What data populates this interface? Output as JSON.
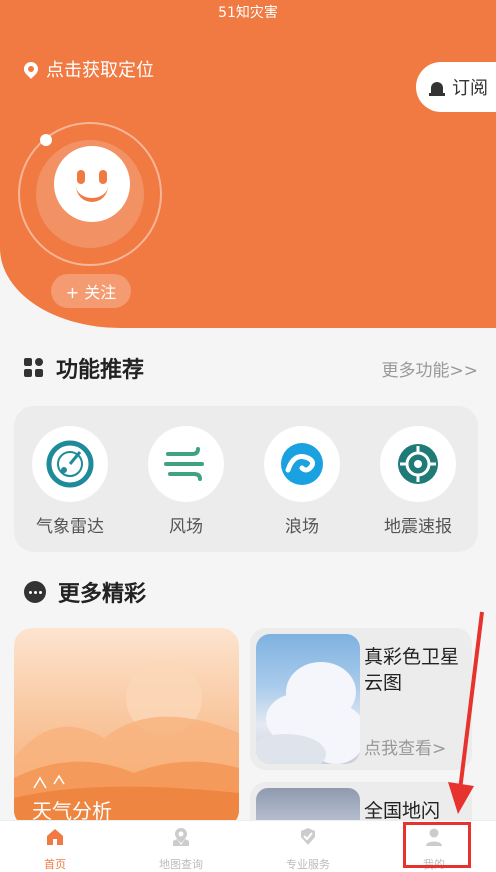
{
  "app_title": "51知灾害",
  "location_label": "点击获取定位",
  "subscribe_label": "订阅",
  "follow_label": "+ 关注",
  "features": {
    "title": "功能推荐",
    "more": "更多功能>>",
    "items": [
      {
        "label": "气象雷达",
        "icon": "radar-icon"
      },
      {
        "label": "风场",
        "icon": "wind-icon"
      },
      {
        "label": "浪场",
        "icon": "wave-icon"
      },
      {
        "label": "地震速报",
        "icon": "earthquake-icon"
      }
    ]
  },
  "more_section": {
    "title": "更多精彩",
    "weather_card": "天气分析",
    "satellite_card": {
      "title": "真彩色卫星云图",
      "link": "点我查看>"
    },
    "lightning_card": "全国地闪"
  },
  "tabs": [
    {
      "label": "首页",
      "icon": "home-icon",
      "active": true
    },
    {
      "label": "地图查询",
      "icon": "map-icon",
      "active": false
    },
    {
      "label": "专业服务",
      "icon": "badge-icon",
      "active": false
    },
    {
      "label": "我的",
      "icon": "user-icon",
      "active": false
    }
  ],
  "colors": {
    "accent": "#f07a42",
    "icon_teal": "#1f8a9a",
    "highlight": "#e8322d"
  }
}
